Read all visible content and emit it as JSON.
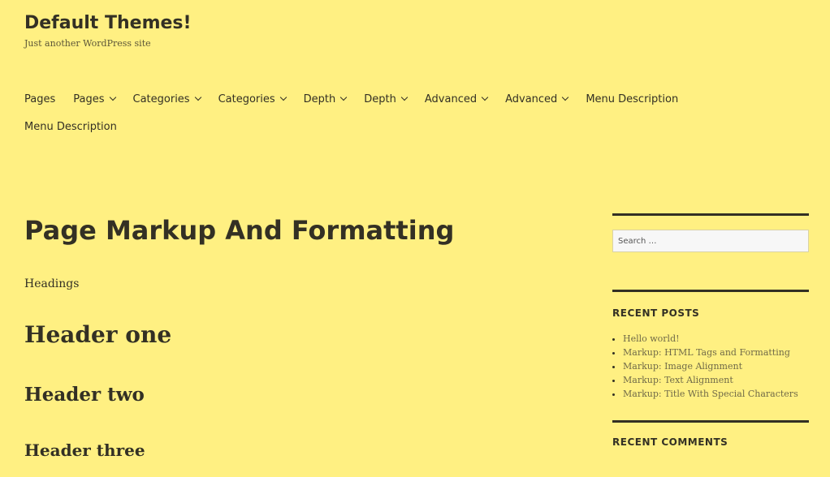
{
  "site": {
    "title": "Default Themes!",
    "tagline": "Just another WordPress site"
  },
  "nav": [
    {
      "label": "Pages",
      "has_submenu": false
    },
    {
      "label": "Pages",
      "has_submenu": true
    },
    {
      "label": "Categories",
      "has_submenu": true
    },
    {
      "label": "Categories",
      "has_submenu": true
    },
    {
      "label": "Depth",
      "has_submenu": true
    },
    {
      "label": "Depth",
      "has_submenu": true
    },
    {
      "label": "Advanced",
      "has_submenu": true
    },
    {
      "label": "Advanced",
      "has_submenu": true
    },
    {
      "label": "Menu Description",
      "has_submenu": false
    },
    {
      "label": "Menu Description",
      "has_submenu": false
    }
  ],
  "content": {
    "title": "Page Markup And Formatting",
    "label": "Headings",
    "headers": [
      "Header one",
      "Header two",
      "Header three"
    ]
  },
  "sidebar": {
    "search": {
      "placeholder": "Search …"
    },
    "recent_posts": {
      "title": "RECENT POSTS",
      "items": [
        "Hello world!",
        "Markup: HTML Tags and Formatting",
        "Markup: Image Alignment",
        "Markup: Text Alignment",
        "Markup: Title With Special Characters"
      ]
    },
    "recent_comments": {
      "title": "RECENT COMMENTS"
    }
  },
  "colors": {
    "background": "#fff082",
    "text": "#333024",
    "link_muted": "#706a48"
  }
}
